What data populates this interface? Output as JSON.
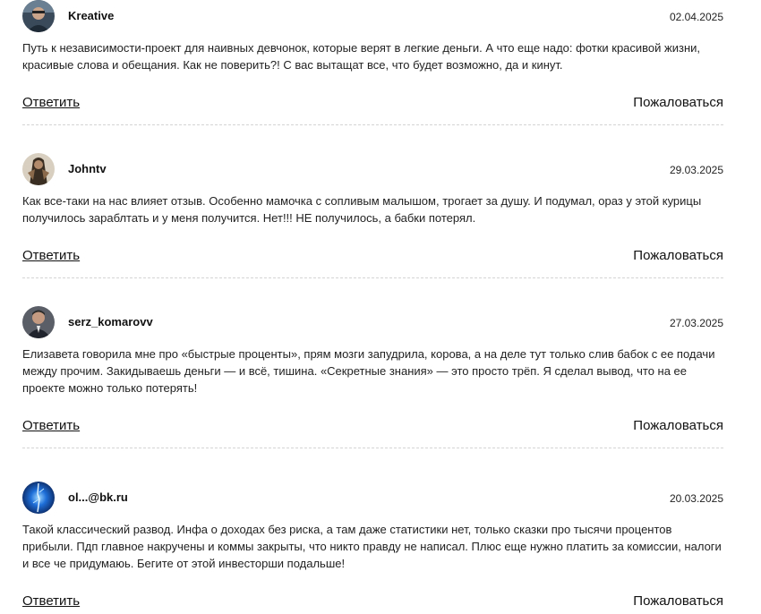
{
  "comments": [
    {
      "author": "Kreative",
      "date": "02.04.2025",
      "text": "Путь к независимости-проект для наивных девчонок, которые верят в легкие деньги. А что еще надо: фотки красивой жизни, красивые слова и обещания. Как не поверить?! С вас вытащат все, что будет возможно, да и кинут.",
      "reply_label": "Ответить",
      "report_label": "Пожаловаться"
    },
    {
      "author": "Johntv",
      "date": "29.03.2025",
      "text": "Как все-таки на нас влияет отзыв. Особенно мамочка с сопливым малышом, трогает за душу. И подумал, ораз у этой курицы получилось зараблтать и у меня получится. Нет!!! НЕ получилось, а бабки потерял.",
      "reply_label": "Ответить",
      "report_label": "Пожаловаться"
    },
    {
      "author": "serz_komarovv",
      "date": "27.03.2025",
      "text": "Елизавета говорила мне про «быстрые проценты», прям мозги запудрила, корова, а на деле тут только слив бабок с ее подачи между прочим. Закидываешь деньги — и всё, тишина. «Секретные знания» — это просто трёп. Я сделал вывод, что на ее проекте можно только потерять!",
      "reply_label": "Ответить",
      "report_label": "Пожаловаться"
    },
    {
      "author": "ol...@bk.ru",
      "date": "20.03.2025",
      "text": "Такой классический развод. Инфа о доходах без риска, а там даже статистики нет, только сказки про тысячи процентов прибыли. Пдп главное накручены и коммы закрыты, что никто правду не написал. Плюс еще нужно платить за комиссии, налоги и все че придумаюь. Бегите от этой инвесторши подальше!",
      "reply_label": "Ответить",
      "report_label": "Пожаловаться"
    }
  ]
}
